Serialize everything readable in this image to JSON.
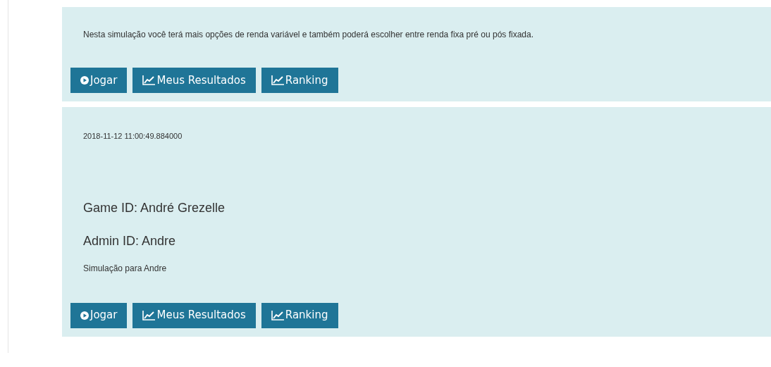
{
  "cards": [
    {
      "description": "Nesta simulação você terá mais opções de renda variável e também poderá escolher entre renda fixa pré ou pós fixada.",
      "buttons": [
        {
          "kind": "play",
          "label": "Jogar"
        },
        {
          "kind": "chart",
          "label": "Meus Resultados"
        },
        {
          "kind": "chart",
          "label": "Ranking"
        }
      ]
    },
    {
      "timestamp": "2018-11-12 11:00:49.884000",
      "game_id": "Game ID: André Grezelle",
      "admin_id": "Admin ID: Andre",
      "description": "Simulação para Andre",
      "buttons": [
        {
          "kind": "play",
          "label": "Jogar"
        },
        {
          "kind": "chart",
          "label": "Meus Resultados"
        },
        {
          "kind": "chart",
          "label": "Ranking"
        }
      ]
    }
  ]
}
